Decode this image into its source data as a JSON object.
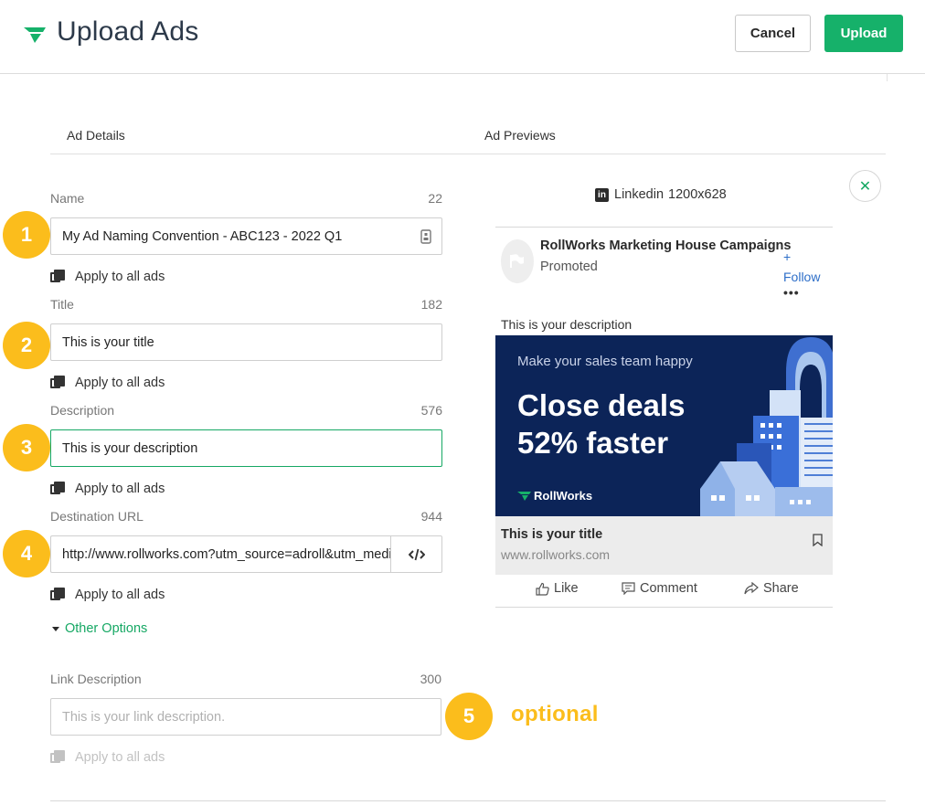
{
  "header": {
    "title": "Upload Ads",
    "cancel_label": "Cancel",
    "upload_label": "Upload",
    "brand_color": "#16b16a"
  },
  "sections": {
    "details": "Ad Details",
    "previews": "Ad Previews"
  },
  "fields": {
    "name": {
      "label": "Name",
      "count": "22",
      "value": "My Ad Naming Convention - ABC123 - 2022 Q1"
    },
    "title": {
      "label": "Title",
      "count": "182",
      "value": "This is your title"
    },
    "description": {
      "label": "Description",
      "count": "576",
      "value": "This is your description"
    },
    "url": {
      "label": "Destination URL",
      "count": "944",
      "value": "http://www.rollworks.com?utm_source=adroll&utm_medium"
    },
    "link_description": {
      "label": "Link Description",
      "count": "300",
      "placeholder": "This is your link description."
    }
  },
  "apply_label": "Apply to all ads",
  "other_options": "Other Options",
  "steps": [
    "1",
    "2",
    "3",
    "4",
    "5"
  ],
  "optional_note": "optional",
  "annotation_color": "#fbbd1c",
  "preview": {
    "network": "Linkedin",
    "size": "1200x628",
    "company": "RollWorks Marketing House Campaigns",
    "promoted": "Promoted",
    "follow_plus": "+",
    "follow": "Follow",
    "more": "•••",
    "description": "This is your description",
    "image": {
      "tagline": "Make your sales team happy",
      "headline_1": "Close deals",
      "headline_2": "52% faster",
      "brand": "RollWorks"
    },
    "ad_title": "This is your title",
    "ad_url": "www.rollworks.com",
    "actions": {
      "like": "Like",
      "comment": "Comment",
      "share": "Share"
    }
  }
}
